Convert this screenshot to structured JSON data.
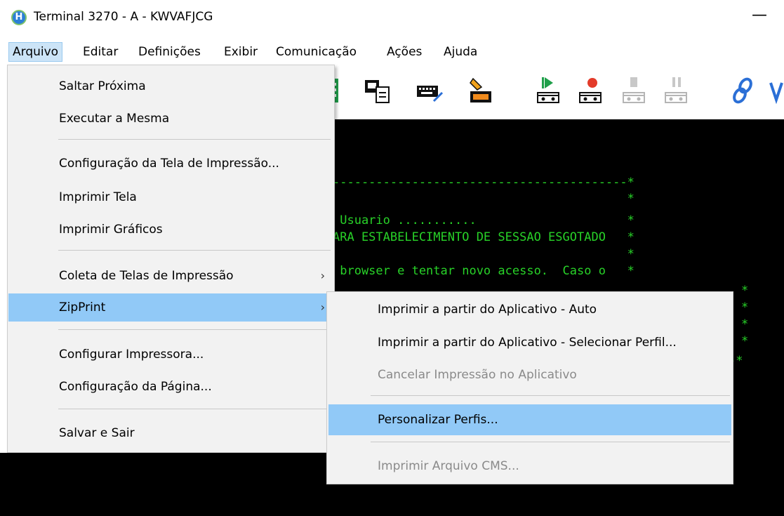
{
  "window": {
    "title": "Terminal 3270 - A - KWVAFJCG",
    "app_icon_letter": "H",
    "minimize_glyph": "—"
  },
  "menubar": {
    "items": [
      "Arquivo",
      "Editar",
      "Definições",
      "Exibir",
      "Comunicação",
      "Ações",
      "Ajuda"
    ]
  },
  "file_menu": {
    "items": [
      "Saltar Próxima",
      "Executar a Mesma",
      "Configuração da Tela de Impressão...",
      "Imprimir Tela",
      "Imprimir Gráficos",
      "Coleta de Telas de Impressão",
      "ZipPrint",
      "Configurar Impressora...",
      "Configuração da Página...",
      "Salvar e Sair"
    ],
    "submenu_arrow": "›"
  },
  "zipprint_submenu": {
    "items": [
      "Imprimir a partir do Aplicativo - Auto",
      "Imprimir a partir do Aplicativo - Selecionar Perfil...",
      "Cancelar Impressão no Aplicativo",
      "Personalizar Perfis...",
      "Imprimir Arquivo CMS..."
    ]
  },
  "terminal": {
    "lines": [
      "-----------------------------------------*",
      "                                         *",
      " Usuario ...........                     *",
      "ARA ESTABELECIMENTO DE SESSAO ESGOTADO   *",
      "                                         *",
      " browser e tentar novo acesso.  Caso o   *"
    ],
    "right_stars": [
      "*",
      "*",
      "*",
      "*"
    ],
    "bottom_line": "-*",
    "text_color": "#28d228"
  },
  "colors": {
    "highlight": "#91c9f7",
    "menu_active": "#cce4f7",
    "disabled_text": "#8a8a8a"
  }
}
